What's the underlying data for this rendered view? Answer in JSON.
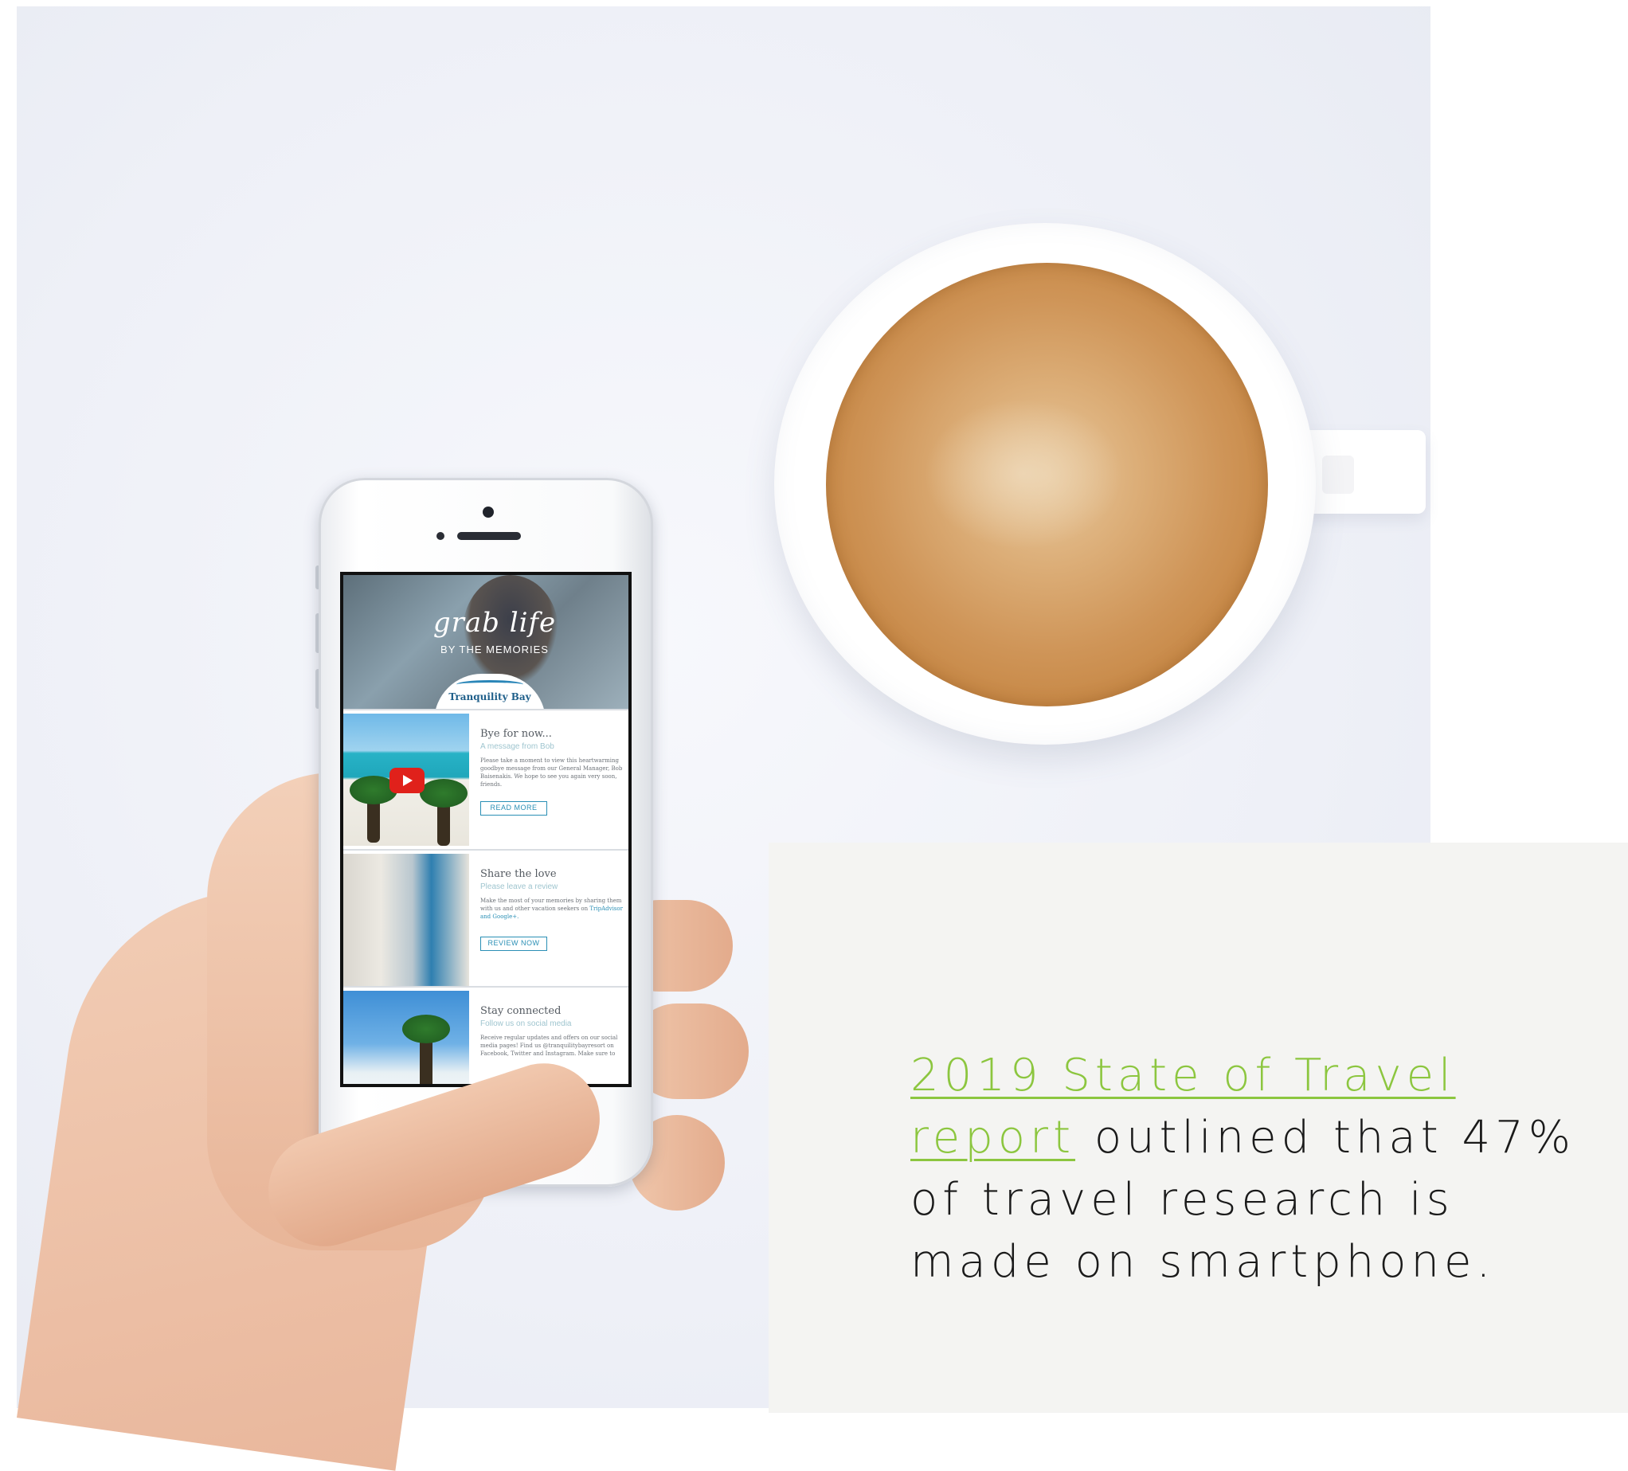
{
  "email": {
    "hero_script": "grab life",
    "hero_tagline": "BY THE MEMORIES",
    "brand": "Tranquility Bay",
    "sections": [
      {
        "title": "Bye for now...",
        "subtitle": "A message from Bob",
        "body": "Please take a moment to view this heartwarming goodbye message from our General Manager, Bob Baisenakis. We hope to see you again very soon, friends.",
        "button": "READ MORE"
      },
      {
        "title": "Share the love",
        "subtitle": "Please leave a review",
        "body": "Make the most of your memories by sharing them with us and other vacation seekers on",
        "body_links": "TripAdvisor and Google+.",
        "button": "REVIEW NOW"
      },
      {
        "title": "Stay connected",
        "subtitle": "Follow us on social media",
        "body": "Receive regular updates and offers on our social media pages! Find us @tranquilitybayresort on Facebook, Twitter and Instagram. Make sure to"
      }
    ]
  },
  "caption": {
    "link_text": "2019 State of Travel report",
    "text": " outlined that 47% of travel research is made on smartphone.",
    "link_color": "#8cc63f",
    "text_color": "#1a1a1a"
  },
  "colors": {
    "card_background": "#f4f4f2",
    "email_accent": "#2a8fb5",
    "youtube_red": "#e0211b"
  },
  "icons": [
    "youtube-play-icon"
  ]
}
